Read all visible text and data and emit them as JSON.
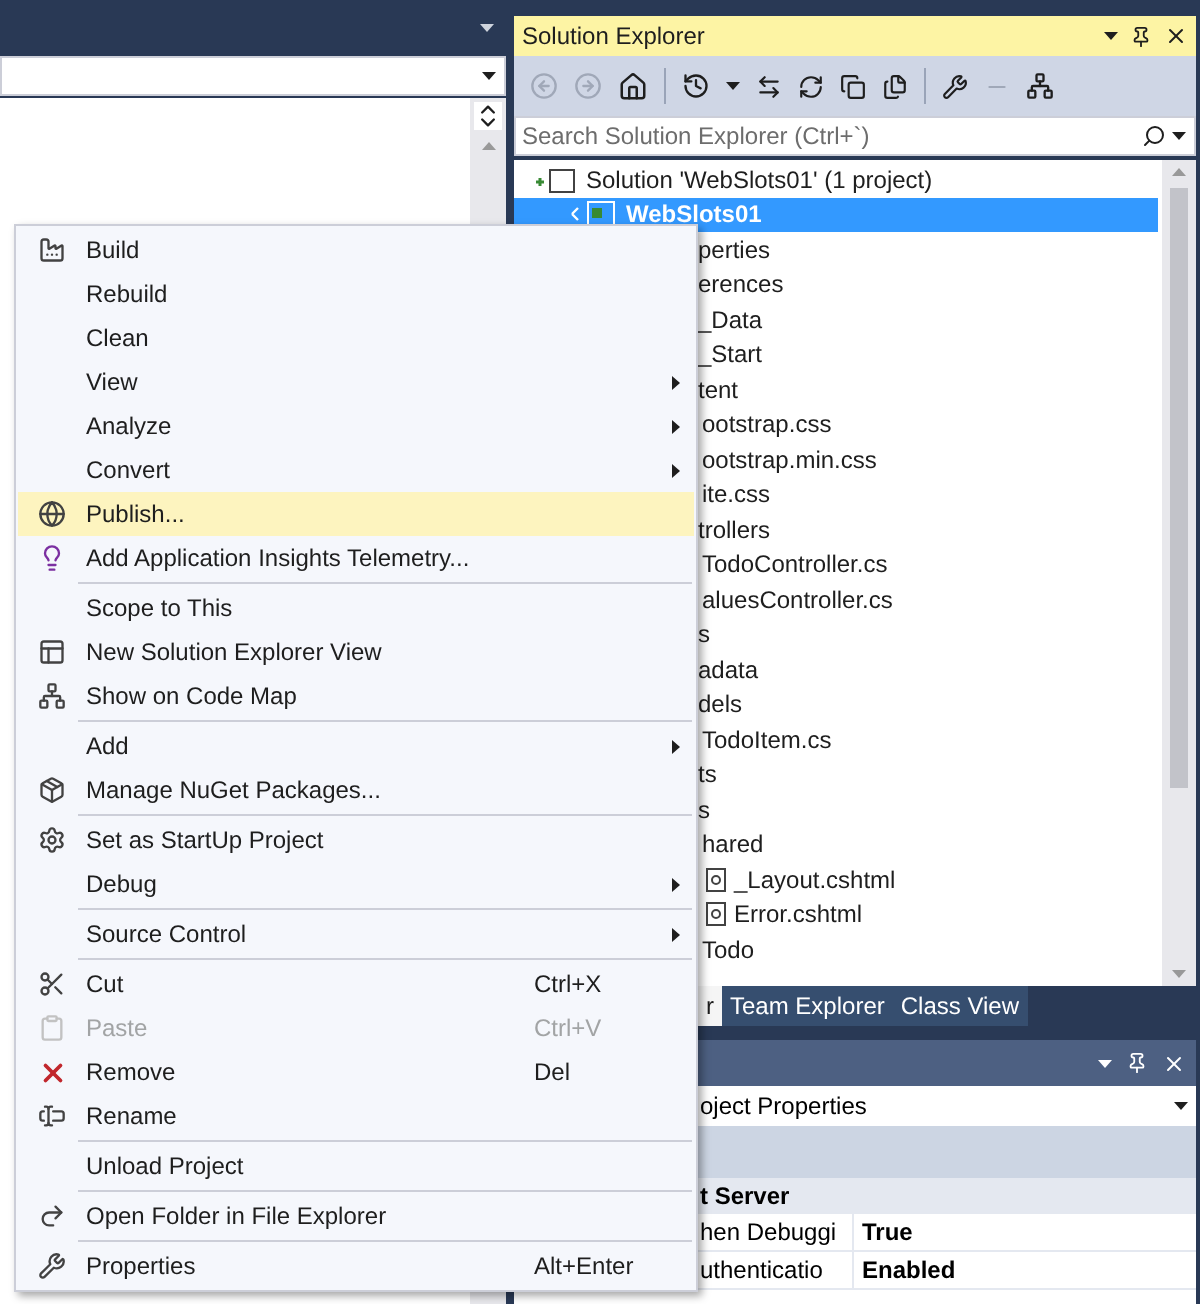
{
  "solution_explorer": {
    "title": "Solution Explorer",
    "search": {
      "placeholder": "Search Solution Explorer (Ctrl+`)"
    },
    "tree": [
      {
        "label": "Solution 'WebSlots01' (1 project)",
        "selected": false,
        "children": [
          {
            "label": "WebSlots01",
            "selected": true,
            "children": [
              {
                "label": "perties",
                "selected": false
              },
              {
                "label": "erences",
                "selected": false
              },
              {
                "label": "_Data",
                "selected": false
              },
              {
                "label": "_Start",
                "selected": false
              },
              {
                "label": "tent",
                "selected": false,
                "children": [
                  {
                    "label": "ootstrap.css",
                    "selected": false
                  },
                  {
                    "label": "ootstrap.min.css",
                    "selected": false
                  },
                  {
                    "label": "ite.css",
                    "selected": false
                  }
                ]
              },
              {
                "label": "trollers",
                "selected": false,
                "children": [
                  {
                    "label": "TodoController.cs",
                    "selected": false
                  },
                  {
                    "label": "aluesController.cs",
                    "selected": false
                  }
                ]
              },
              {
                "label": "s",
                "selected": false
              },
              {
                "label": "adata",
                "selected": false
              },
              {
                "label": "dels",
                "selected": false,
                "children": [
                  {
                    "label": "TodoItem.cs",
                    "selected": false
                  }
                ]
              },
              {
                "label": "ts",
                "selected": false
              },
              {
                "label": "s",
                "selected": false,
                "children": [
                  {
                    "label": "hared",
                    "selected": false,
                    "children": [
                      {
                        "label": "_Layout.cshtml",
                        "selected": false
                      },
                      {
                        "label": "Error.cshtml",
                        "selected": false
                      }
                    ]
                  },
                  {
                    "label": "Todo",
                    "selected": false
                  }
                ]
              }
            ]
          }
        ]
      }
    ]
  },
  "tabs": [
    {
      "label": "r",
      "selected": true
    },
    {
      "label": "Team Explorer",
      "selected": false
    },
    {
      "label": "Class View",
      "selected": false
    }
  ],
  "properties": {
    "object": "oject Properties",
    "category": "t Server",
    "rows": [
      {
        "name": "hen Debuggi",
        "value": "True"
      },
      {
        "name": "uthenticatio",
        "value": "Enabled"
      }
    ]
  },
  "context_menu": {
    "items": [
      {
        "kind": "item",
        "label": "Build",
        "submenu": false,
        "disabled": false,
        "selected": false
      },
      {
        "kind": "item",
        "label": "Rebuild",
        "submenu": false,
        "disabled": false,
        "selected": false
      },
      {
        "kind": "item",
        "label": "Clean",
        "submenu": false,
        "disabled": false,
        "selected": false
      },
      {
        "kind": "item",
        "label": "View",
        "submenu": true,
        "disabled": false,
        "selected": false
      },
      {
        "kind": "item",
        "label": "Analyze",
        "submenu": true,
        "disabled": false,
        "selected": false
      },
      {
        "kind": "item",
        "label": "Convert",
        "submenu": true,
        "disabled": false,
        "selected": false
      },
      {
        "kind": "item",
        "label": "Publish...",
        "submenu": false,
        "disabled": false,
        "selected": true
      },
      {
        "kind": "item",
        "label": "Add Application Insights Telemetry...",
        "submenu": false,
        "disabled": false,
        "selected": false
      },
      {
        "kind": "separator"
      },
      {
        "kind": "item",
        "label": "Scope to This",
        "submenu": false,
        "disabled": false,
        "selected": false
      },
      {
        "kind": "item",
        "label": "New Solution Explorer View",
        "submenu": false,
        "disabled": false,
        "selected": false
      },
      {
        "kind": "item",
        "label": "Show on Code Map",
        "submenu": false,
        "disabled": false,
        "selected": false
      },
      {
        "kind": "separator"
      },
      {
        "kind": "item",
        "label": "Add",
        "submenu": true,
        "disabled": false,
        "selected": false
      },
      {
        "kind": "item",
        "label": "Manage NuGet Packages...",
        "submenu": false,
        "disabled": false,
        "selected": false
      },
      {
        "kind": "separator"
      },
      {
        "kind": "item",
        "label": "Set as StartUp Project",
        "submenu": false,
        "disabled": false,
        "selected": false
      },
      {
        "kind": "item",
        "label": "Debug",
        "submenu": true,
        "disabled": false,
        "selected": false
      },
      {
        "kind": "separator"
      },
      {
        "kind": "item",
        "label": "Source Control",
        "submenu": true,
        "disabled": false,
        "selected": false
      },
      {
        "kind": "separator"
      },
      {
        "kind": "item",
        "label": "Cut",
        "shortcut": "Ctrl+X",
        "submenu": false,
        "disabled": false,
        "selected": false
      },
      {
        "kind": "item",
        "label": "Paste",
        "shortcut": "Ctrl+V",
        "submenu": false,
        "disabled": true,
        "selected": false
      },
      {
        "kind": "item",
        "label": "Remove",
        "shortcut": "Del",
        "submenu": false,
        "disabled": false,
        "selected": false
      },
      {
        "kind": "item",
        "label": "Rename",
        "submenu": false,
        "disabled": false,
        "selected": false
      },
      {
        "kind": "separator"
      },
      {
        "kind": "item",
        "label": "Unload Project",
        "submenu": false,
        "disabled": false,
        "selected": false
      },
      {
        "kind": "separator"
      },
      {
        "kind": "item",
        "label": "Open Folder in File Explorer",
        "submenu": false,
        "disabled": false,
        "selected": false
      },
      {
        "kind": "separator"
      },
      {
        "kind": "item",
        "label": "Properties",
        "shortcut": "Alt+Enter",
        "submenu": false,
        "disabled": false,
        "selected": false
      }
    ]
  }
}
